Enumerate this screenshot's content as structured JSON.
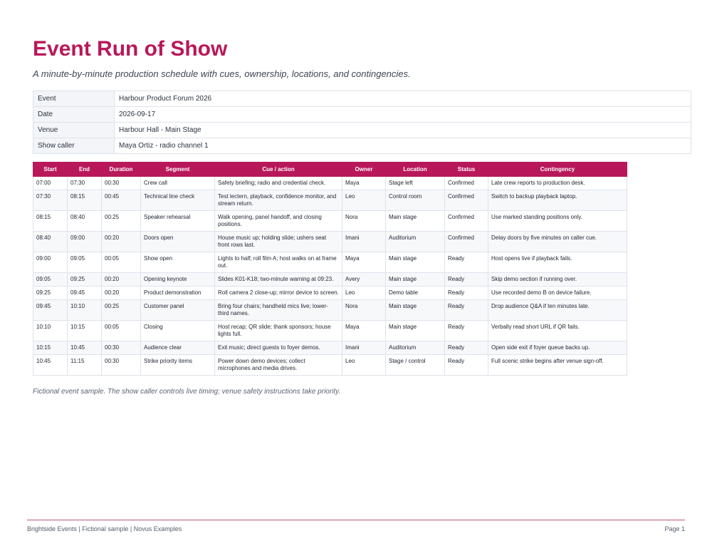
{
  "title": "Event Run of Show",
  "subtitle": "A minute-by-minute production schedule with cues, ownership, locations, and contingencies.",
  "meta": [
    {
      "key": "Event",
      "value": "Harbour Product Forum 2026"
    },
    {
      "key": "Date",
      "value": "2026-09-17"
    },
    {
      "key": "Venue",
      "value": "Harbour Hall - Main Stage"
    },
    {
      "key": "Show caller",
      "value": "Maya Ortiz - radio channel 1"
    }
  ],
  "schedule": {
    "columns": [
      "Start",
      "End",
      "Duration",
      "Segment",
      "Cue / action",
      "Owner",
      "Location",
      "Status",
      "Contingency"
    ],
    "rows": [
      [
        "07:00",
        "07:30",
        "00:30",
        "Crew call",
        "Safety briefing; radio and credential check.",
        "Maya",
        "Stage left",
        "Confirmed",
        "Late crew reports to production desk."
      ],
      [
        "07:30",
        "08:15",
        "00:45",
        "Technical line check",
        "Test lectern, playback, confidence monitor, and stream return.",
        "Leo",
        "Control room",
        "Confirmed",
        "Switch to backup playback laptop."
      ],
      [
        "08:15",
        "08:40",
        "00:25",
        "Speaker rehearsal",
        "Walk opening, panel handoff, and closing positions.",
        "Nora",
        "Main stage",
        "Confirmed",
        "Use marked standing positions only."
      ],
      [
        "08:40",
        "09:00",
        "00:20",
        "Doors open",
        "House music up; holding slide; ushers seat front rows last.",
        "Imani",
        "Auditorium",
        "Confirmed",
        "Delay doors by five minutes on caller cue."
      ],
      [
        "09:00",
        "09:05",
        "00:05",
        "Show open",
        "Lights to half; roll film A; host walks on at frame out.",
        "Maya",
        "Main stage",
        "Ready",
        "Host opens live if playback fails."
      ],
      [
        "09:05",
        "09:25",
        "00:20",
        "Opening keynote",
        "Slides K01-K18; two-minute warning at 09:23.",
        "Avery",
        "Main stage",
        "Ready",
        "Skip demo section if running over."
      ],
      [
        "09:25",
        "09:45",
        "00:20",
        "Product demonstration",
        "Roll camera 2 close-up; mirror device to screen.",
        "Leo",
        "Demo table",
        "Ready",
        "Use recorded demo B on device failure."
      ],
      [
        "09:45",
        "10:10",
        "00:25",
        "Customer panel",
        "Bring four chairs; handheld mics live; lower-third names.",
        "Nora",
        "Main stage",
        "Ready",
        "Drop audience Q&A if ten minutes late."
      ],
      [
        "10:10",
        "10:15",
        "00:05",
        "Closing",
        "Host recap; QR slide; thank sponsors; house lights full.",
        "Maya",
        "Main stage",
        "Ready",
        "Verbally read short URL if QR fails."
      ],
      [
        "10:15",
        "10:45",
        "00:30",
        "Audience clear",
        "Exit music; direct guests to foyer demos.",
        "Imani",
        "Auditorium",
        "Ready",
        "Open side exit if foyer queue backs up."
      ],
      [
        "10:45",
        "11:15",
        "00:30",
        "Strike priority items",
        "Power down demo devices; collect microphones and media drives.",
        "Leo",
        "Stage / control",
        "Ready",
        "Full scenic strike begins after venue sign-off."
      ]
    ]
  },
  "note": "Fictional event sample. The show caller controls live timing; venue safety instructions take priority.",
  "footer": {
    "left": "Brightside Events | Fictional sample | Novus Examples",
    "right": "Page 1"
  },
  "colors": {
    "accent": "#b8185a"
  }
}
